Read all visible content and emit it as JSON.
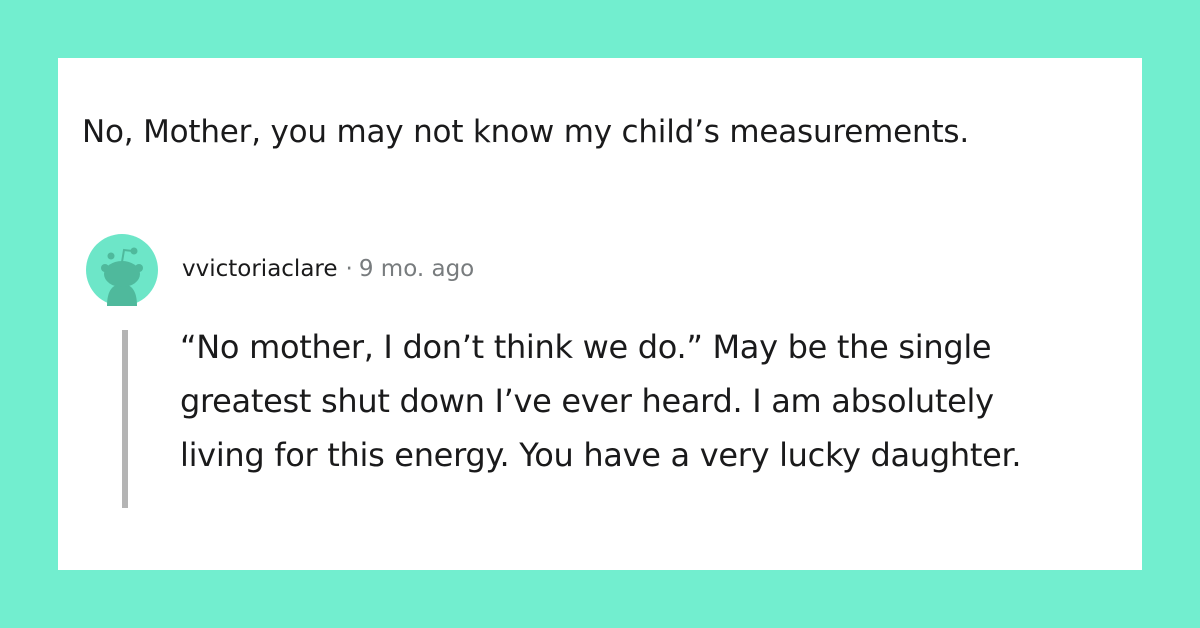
{
  "post": {
    "title": "No, Mother, you may not know my child’s measurements."
  },
  "comment": {
    "username": "vvictoriaclare",
    "separator": "·",
    "timestamp": "9 mo. ago",
    "body": "“No mother, I don’t think we do.” May be the single greatest shut down I’ve ever heard. I am absolutely living for this energy. You have a very lucky daughter."
  },
  "colors": {
    "background": "#72eecf",
    "card": "#ffffff",
    "avatar_bg": "#6de6c8",
    "avatar_figure": "#4fb99c",
    "thread_line": "#b4b4b4",
    "meta_text": "#787c7e"
  },
  "icons": {
    "avatar": "reddit-snoo-avatar-icon"
  }
}
